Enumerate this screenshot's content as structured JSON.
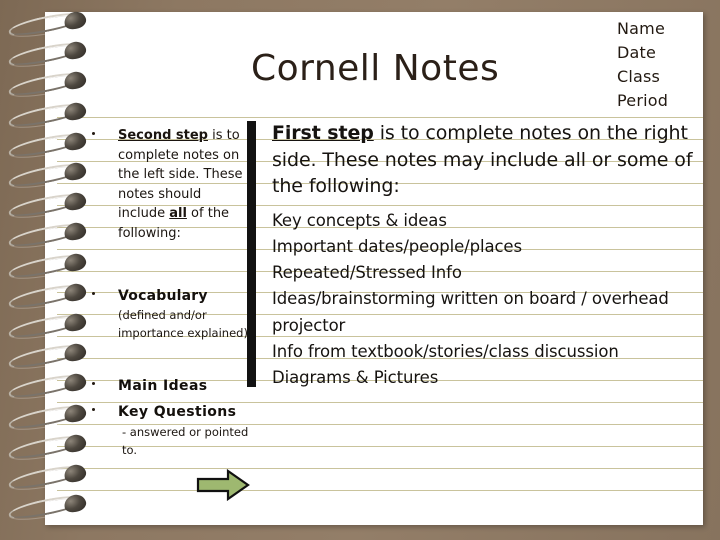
{
  "slide": {
    "background_color": "#8a7560",
    "page_color": "#ffffff",
    "rule_color": "#c9c39c",
    "title": "Cornell Notes",
    "divider_color": "#121212"
  },
  "header": {
    "lines": [
      "Name",
      "Date",
      "Class",
      "Period"
    ]
  },
  "cue_column": {
    "items": [
      {
        "bold_underlined_lead": "Second step",
        "text": " is to complete notes on the left side. These notes should include ",
        "bold_underlined_mid": "all",
        "text_tail": " of the following:"
      },
      {
        "heading": "Vocabulary",
        "subtext": "(defined and/or importance explained)"
      },
      {
        "heading": "Main Ideas"
      },
      {
        "heading": "Key Questions",
        "subtext": "-  answered or pointed to."
      }
    ]
  },
  "notes_column": {
    "intro_bold_underlined": "First step",
    "intro_rest": " is to complete notes on the right side. These notes may include all or some of the following:",
    "items": [
      "Key concepts & ideas",
      "Important dates/people/places",
      "Repeated/Stressed Info",
      "Ideas/brainstorming written on board / overhead projector",
      "Info from textbook/stories/class discussion",
      "Diagrams & Pictures"
    ]
  },
  "arrow": {
    "name": "right-arrow",
    "fill_color": "#9eb870",
    "stroke_color": "#111111"
  },
  "spiral": {
    "coil_count": 17,
    "wire_color": "#b9b2a6",
    "bead_color": "#2c2823"
  }
}
